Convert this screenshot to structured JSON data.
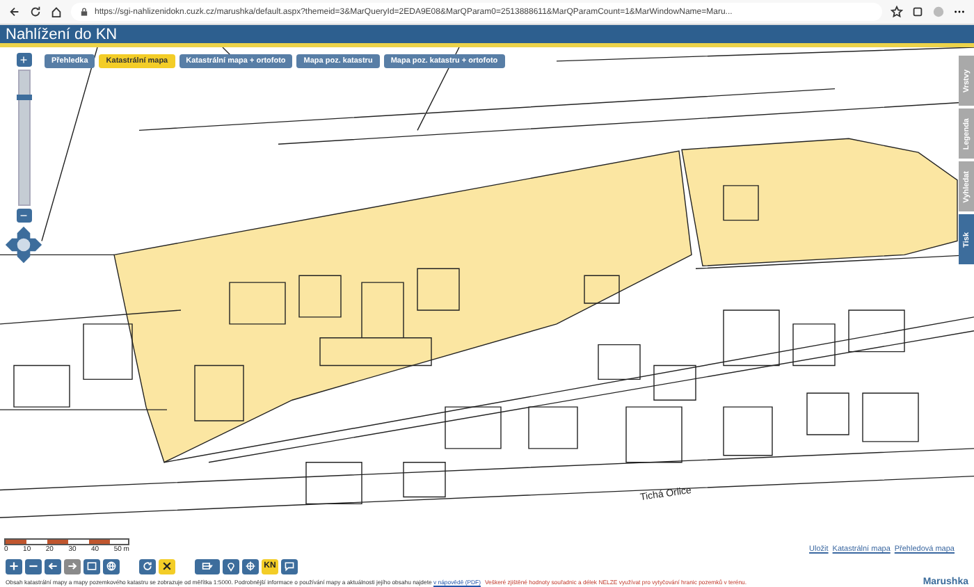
{
  "browser": {
    "url": "https://sgi-nahlizenidokn.cuzk.cz/marushka/default.aspx?themeid=3&MarQueryId=2EDA9E08&MarQParam0=2513888611&MarQParamCount=1&MarWindowName=Maru..."
  },
  "header": {
    "title": "Nahlížení do KN"
  },
  "map_tabs": [
    {
      "label": "Přehledka",
      "selected": false
    },
    {
      "label": "Katastrální mapa",
      "selected": true
    },
    {
      "label": "Katastrální mapa + ortofoto",
      "selected": false
    },
    {
      "label": "Mapa poz. katastru",
      "selected": false
    },
    {
      "label": "Mapa poz. katastru + ortofoto",
      "selected": false
    }
  ],
  "side_tabs": [
    {
      "label": "Vrstvy",
      "selected": false
    },
    {
      "label": "Legenda",
      "selected": false
    },
    {
      "label": "Vyhledat",
      "selected": false
    },
    {
      "label": "Tisk",
      "selected": true
    }
  ],
  "zoom": {
    "plus": "+",
    "minus": "−",
    "level": 0.8
  },
  "map": {
    "street_label": "Tichá Orlice",
    "scale_labels": [
      "0",
      "10",
      "20",
      "30",
      "40",
      "50 m"
    ],
    "links": [
      "Uložit",
      "Katastrální mapa",
      "Přehledová mapa"
    ]
  },
  "toolbar": [
    {
      "kind": "plus",
      "selected": false
    },
    {
      "kind": "minus",
      "selected": false
    },
    {
      "kind": "back",
      "selected": false
    },
    {
      "kind": "forward",
      "selected": false,
      "disabled": true
    },
    {
      "kind": "extent",
      "selected": false
    },
    {
      "kind": "globe",
      "selected": false
    },
    {
      "kind": "refresh",
      "selected": false
    },
    {
      "kind": "cross",
      "selected": true
    },
    {
      "kind": "layers",
      "selected": false
    },
    {
      "kind": "pin",
      "selected": false
    },
    {
      "kind": "target",
      "selected": false
    },
    {
      "kind": "kn",
      "label": "KN",
      "selected": true
    },
    {
      "kind": "chat",
      "selected": false
    }
  ],
  "footer": {
    "text": "Obsah katastrální mapy a mapy pozemkového katastru se zobrazuje od měřítka 1:5000. Podrobnější informace o používání mapy a aktuálnosti jejího obsahu najdete",
    "link": "v nápovědě (PDF)",
    "warning": "Veškeré zjištěné hodnoty souřadnic a délek NELZE využívat pro vytyčování hranic pozemků v terénu.",
    "brand": "Marushka"
  }
}
